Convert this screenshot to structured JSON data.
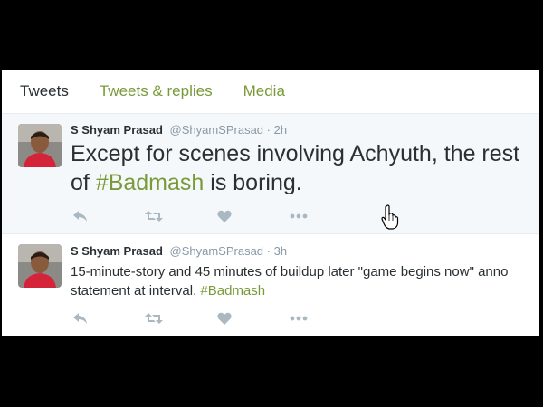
{
  "tabs": [
    {
      "label": "Tweets",
      "active": true
    },
    {
      "label": "Tweets & replies",
      "active": false
    },
    {
      "label": "Media",
      "active": false
    }
  ],
  "colors": {
    "accent": "#7a9a3a",
    "text": "#292f33",
    "muted": "#8899a6",
    "icon": "#aab8c2",
    "highlight_bg": "#f5f8fa"
  },
  "tweets": [
    {
      "name": "S Shyam Prasad",
      "handle": "@ShyamSPrasad",
      "time": "2h",
      "text_before": "Except for scenes involving Achyuth, the rest of ",
      "hashtag": "#Badmash",
      "text_after": " is boring."
    },
    {
      "name": "S Shyam Prasad",
      "handle": "@ShyamSPrasad",
      "time": "3h",
      "text_before": "15-minute-story and 45 minutes of buildup later \"game begins now\" anno statement at interval. ",
      "hashtag": "#Badmash",
      "text_after": ""
    }
  ],
  "icons": [
    "reply-icon",
    "retweet-icon",
    "like-icon",
    "more-icon",
    "hand-cursor-icon"
  ]
}
